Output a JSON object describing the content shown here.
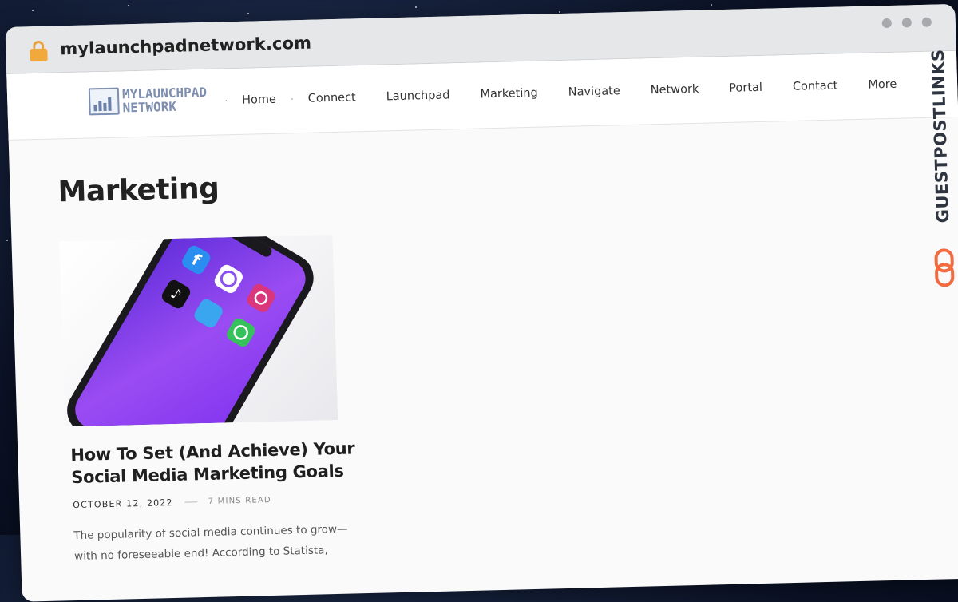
{
  "browser": {
    "url": "mylaunchpadnetwork.com"
  },
  "site": {
    "logo_line1": "MYLAUNCHPAD",
    "logo_line2": "NETWORK",
    "nav": [
      {
        "label": "Home"
      },
      {
        "label": "Connect"
      },
      {
        "label": "Launchpad"
      },
      {
        "label": "Marketing"
      },
      {
        "label": "Navigate"
      },
      {
        "label": "Network"
      },
      {
        "label": "Portal"
      },
      {
        "label": "Contact"
      },
      {
        "label": "More"
      }
    ]
  },
  "main": {
    "page_title": "Marketing",
    "post": {
      "title": "How To Set (And Achieve) Your Social Media Marketing Goals",
      "date": "OCTOBER 12, 2022",
      "read_time": "7 MINS READ",
      "excerpt": "The popularity of social media continues to grow—with no foreseeable end! According to Statista,"
    }
  },
  "watermark": {
    "text": "GUESTPOSTLINKS"
  },
  "colors": {
    "accent_orange": "#f26a3d",
    "lock": "#f2a93b",
    "phone_screen": "#8a3cf0"
  }
}
